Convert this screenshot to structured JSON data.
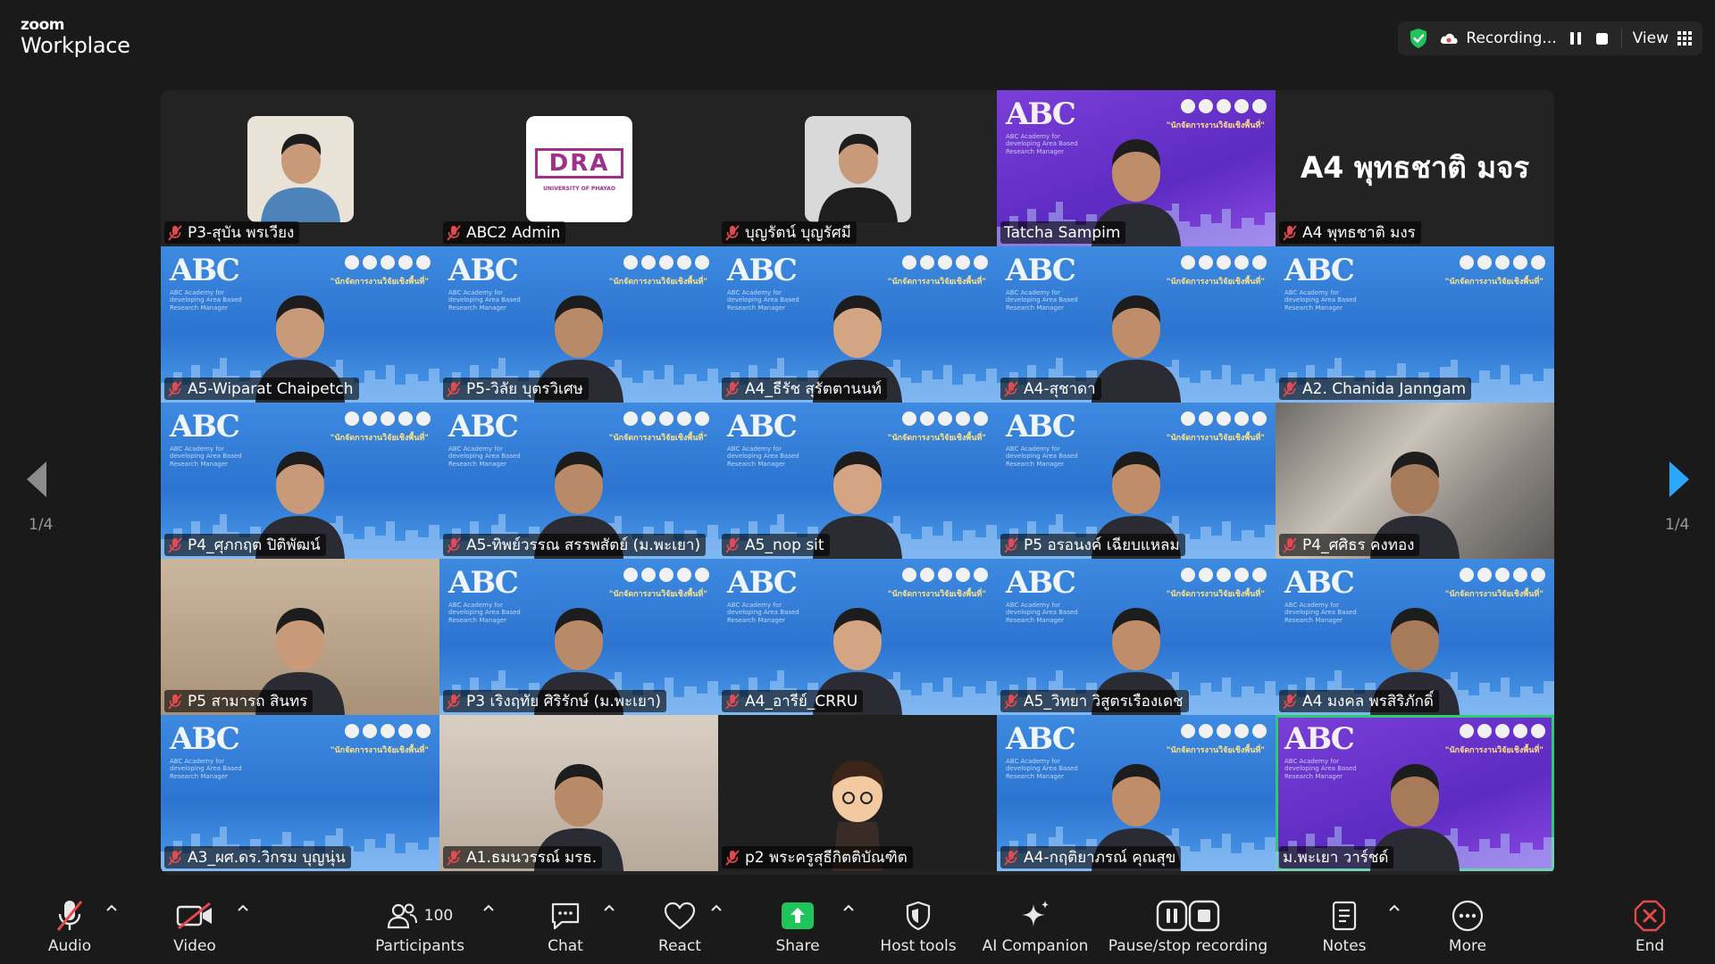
{
  "app": {
    "brand_small": "zoom",
    "brand_large": "Workplace"
  },
  "recording": {
    "status": "Recording...",
    "view_label": "View"
  },
  "gallery": {
    "page_left": "1/4",
    "page_right": "1/4",
    "banner_title": "ABC",
    "banner_subtitle": "ABC Academy for developing Area Based Research Manager",
    "banner_heading": "\"นักจัดการงานวิจัยเชิงพื้นที่\"",
    "tiles": [
      {
        "name": "P3-สุบัน พรเวียง"
      },
      {
        "name": "ABC2 Admin",
        "avatar_text": "DRA",
        "avatar_sub": "UNIVERSITY OF PHAYAO"
      },
      {
        "name": "บุญรัตน์ บุญรัศมี"
      },
      {
        "name": "Tatcha Sampim"
      },
      {
        "name": "A4 พุทธชาติ มงร",
        "big_label": "A4 พุทธชาติ มจร"
      },
      {
        "name": "A5-Wiparat Chaipetch"
      },
      {
        "name": "P5-วิลัย บุตรวิเศษ"
      },
      {
        "name": "A4_ธีรัช สุรัตตานนท์"
      },
      {
        "name": "A4-สุชาดา"
      },
      {
        "name": "A2. Chanida Janngam"
      },
      {
        "name": "P4_ศุภกฤต ปิติพัฒน์"
      },
      {
        "name": "A5-ทิพย์วรรณ สรรพสัตย์ (ม.พะเยา)"
      },
      {
        "name": "A5_nop sit"
      },
      {
        "name": "P5 อรอนงค์ เฉียบแหลม"
      },
      {
        "name": "P4_ศศิธร คงทอง"
      },
      {
        "name": "P5 สามารถ สินทร"
      },
      {
        "name": "P3 เริงฤทัย ศิริรักษ์ (ม.พะเยา)"
      },
      {
        "name": "A4_อารีย์_CRRU"
      },
      {
        "name": "A5_วิทยา วิสูตรเรืองเดช"
      },
      {
        "name": "A4 มงคล พรสิริภักดิ์"
      },
      {
        "name": "A3_ผศ.ดร.วิกรม บุญนุ่น"
      },
      {
        "name": "A1.ธมนวรรณ์ มรธ."
      },
      {
        "name": "p2 พระครูสุธีกิตติบัณฑิต"
      },
      {
        "name": "A4-กฤติยาภรณ์ คุณสุข"
      },
      {
        "name": "ม.พะเยา วาร์ชด์"
      }
    ]
  },
  "toolbar": {
    "audio": "Audio",
    "video": "Video",
    "participants": "Participants",
    "participants_count": "100",
    "chat": "Chat",
    "react": "React",
    "share": "Share",
    "host_tools": "Host tools",
    "ai_companion": "AI Companion",
    "pause_stop": "Pause/stop recording",
    "notes": "Notes",
    "more": "More",
    "end": "End"
  },
  "colors": {
    "active_speaker": "#2ecc71",
    "share_green": "#21c45a",
    "end_red": "#e5484d",
    "mic_off_red": "#e5484d"
  }
}
